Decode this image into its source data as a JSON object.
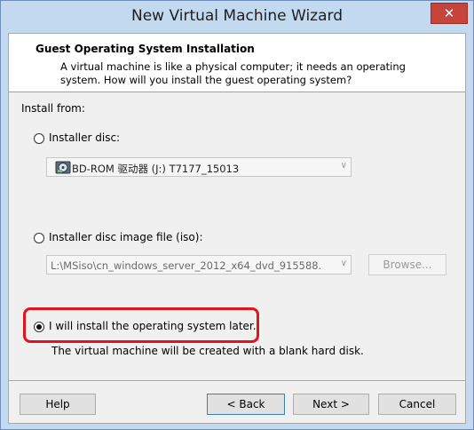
{
  "window": {
    "title": "New Virtual Machine Wizard",
    "close_glyph": "✕"
  },
  "header": {
    "title": "Guest Operating System Installation",
    "description": "A virtual machine is like a physical computer; it needs an operating system. How will you install the guest operating system?"
  },
  "install_from": {
    "label": "Install from:",
    "options": [
      {
        "label": "Installer disc:",
        "selected": false
      },
      {
        "label": "Installer disc image file (iso):",
        "selected": false
      },
      {
        "label": "I will install the operating system later.",
        "selected": true
      }
    ],
    "disc_combo": {
      "value": "BD-ROM 驱动器 (J:) T7177_15013",
      "icon": "disc-drive-icon"
    },
    "iso_combo": {
      "value": "L:\\MSiso\\cn_windows_server_2012_x64_dvd_915588."
    },
    "browse_label": "Browse...",
    "later_note": "The virtual machine will be created with a blank hard disk."
  },
  "footer": {
    "help_label": "Help",
    "back_label": "< Back",
    "next_label": "Next >",
    "cancel_label": "Cancel"
  },
  "colors": {
    "title_bar": "#c3d9f0",
    "close_button": "#c7443a",
    "highlight_annotation": "#e0141a",
    "dialog_background": "#f0f0f0"
  }
}
